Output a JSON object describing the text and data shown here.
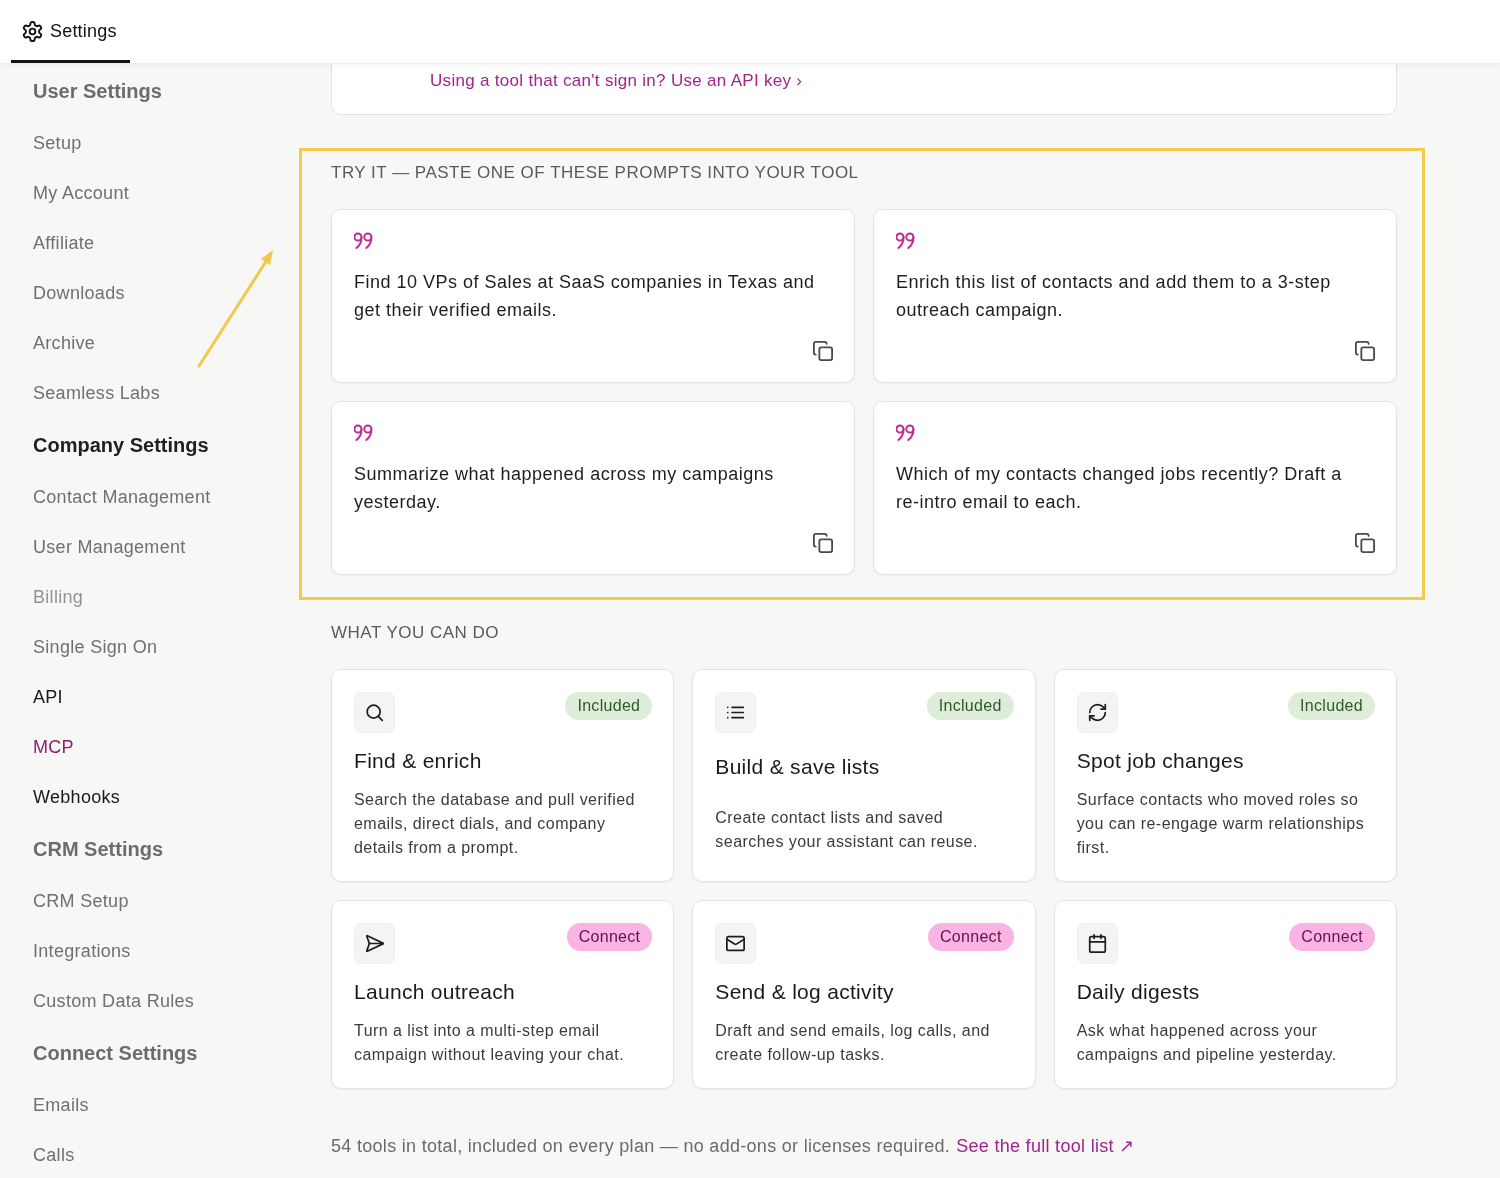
{
  "header": {
    "tabs": [
      {
        "label": "Settings",
        "selected": true
      }
    ]
  },
  "sidebar": {
    "sections": [
      {
        "heading": {
          "label": "User Settings",
          "muted": true
        },
        "items": [
          {
            "label": "Setup",
            "muted": true,
            "selected": false,
            "disabled": false
          },
          {
            "label": "My Account",
            "muted": true,
            "selected": false,
            "disabled": false
          },
          {
            "label": "Affiliate",
            "muted": true,
            "selected": false,
            "disabled": false
          },
          {
            "label": "Downloads",
            "muted": true,
            "selected": false,
            "disabled": false
          },
          {
            "label": "Archive",
            "muted": true,
            "selected": false,
            "disabled": false
          },
          {
            "label": "Seamless Labs",
            "muted": true,
            "selected": false,
            "disabled": false
          }
        ]
      },
      {
        "heading": {
          "label": "Company Settings",
          "muted": false
        },
        "items": [
          {
            "label": "Contact Management",
            "muted": true,
            "selected": false,
            "disabled": false
          },
          {
            "label": "User Management",
            "muted": true,
            "selected": false,
            "disabled": false
          },
          {
            "label": "Billing",
            "muted": true,
            "selected": false,
            "disabled": true
          },
          {
            "label": "Single Sign On",
            "muted": true,
            "selected": false,
            "disabled": false
          },
          {
            "label": "API",
            "muted": false,
            "selected": false,
            "disabled": false
          },
          {
            "label": "MCP",
            "muted": false,
            "selected": true,
            "disabled": false
          },
          {
            "label": "Webhooks",
            "muted": false,
            "selected": false,
            "disabled": false
          }
        ]
      },
      {
        "heading": {
          "label": "CRM Settings",
          "muted": true
        },
        "items": [
          {
            "label": "CRM Setup",
            "muted": true,
            "selected": false,
            "disabled": false
          },
          {
            "label": "Integrations",
            "muted": true,
            "selected": false,
            "disabled": false
          },
          {
            "label": "Custom Data Rules",
            "muted": true,
            "selected": false,
            "disabled": false
          }
        ]
      },
      {
        "heading": {
          "label": "Connect Settings",
          "muted": true
        },
        "items": [
          {
            "label": "Emails",
            "muted": true,
            "selected": false,
            "disabled": false
          },
          {
            "label": "Calls",
            "muted": true,
            "selected": false,
            "disabled": false
          }
        ]
      }
    ]
  },
  "api_key_card": {
    "link": "Using a tool that can't sign in? Use an API key ›"
  },
  "prompts": {
    "title": "TRY IT — PASTE ONE OF THESE PROMPTS INTO YOUR TOOL",
    "highlighted": true,
    "items": [
      {
        "text": "Find 10 VPs of Sales at SaaS companies in Texas and get their verified emails."
      },
      {
        "text": "Enrich this list of contacts and add them to a 3-step outreach campaign."
      },
      {
        "text": "Summarize what happened across my campaigns yesterday."
      },
      {
        "text": "Which of my contacts changed jobs recently? Draft a re-intro email to each."
      }
    ]
  },
  "capabilities": {
    "title": "WHAT YOU CAN DO",
    "items": [
      {
        "title": "Find & enrich",
        "badge": {
          "label": "Included",
          "kind": "included"
        },
        "description": "Search the database and pull verified emails, direct dials, and company details from a prompt."
      },
      {
        "title": "Build & save lists",
        "badge": {
          "label": "Included",
          "kind": "included"
        },
        "description": "Create contact lists and saved searches your assistant can reuse."
      },
      {
        "title": "Spot job changes",
        "badge": {
          "label": "Included",
          "kind": "included"
        },
        "description": "Surface contacts who moved roles so you can re-engage warm relationships first."
      },
      {
        "title": "Launch outreach",
        "badge": {
          "label": "Connect",
          "kind": "connect"
        },
        "description": "Turn a list into a multi-step email campaign without leaving your chat."
      },
      {
        "title": "Send & log activity",
        "badge": {
          "label": "Connect",
          "kind": "connect"
        },
        "description": "Draft and send emails, log calls, and create follow-up tasks."
      },
      {
        "title": "Daily digests",
        "badge": {
          "label": "Connect",
          "kind": "connect"
        },
        "description": "Ask what happened across your campaigns and pipeline yesterday."
      }
    ]
  },
  "footer": {
    "text": "54 tools in total, included on every plan — no add-ons or licenses required.",
    "link": "See the full tool list ↗"
  }
}
